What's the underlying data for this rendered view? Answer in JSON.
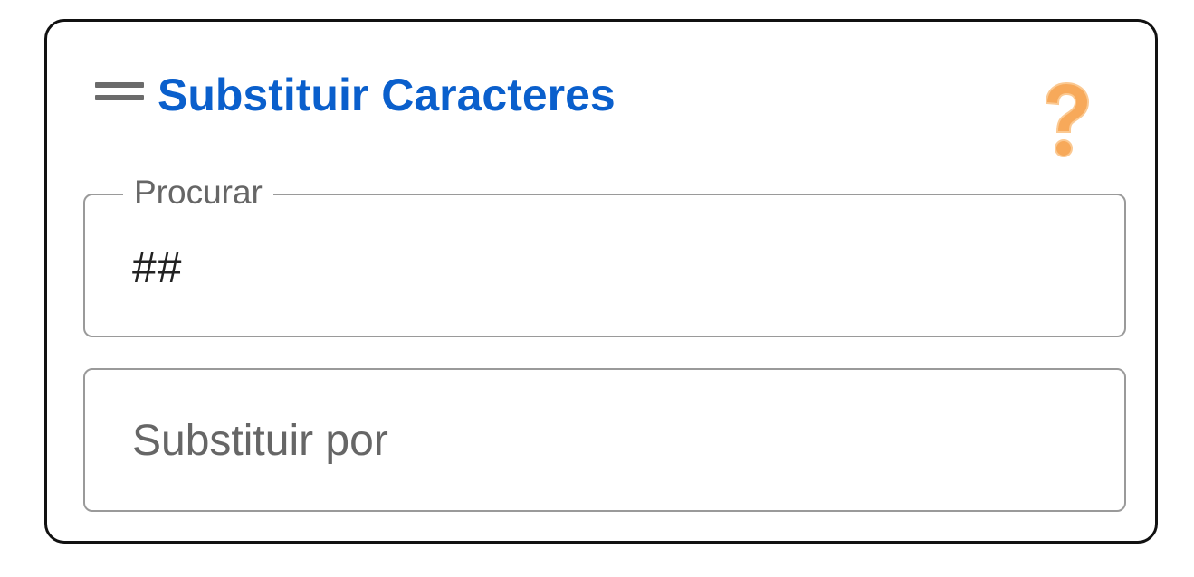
{
  "panel": {
    "title": "Substituir Caracteres",
    "title_color": "#0a5fcc",
    "drag_icon": "drag-handle-icon",
    "help_icon": "question-mark-icon",
    "help_icon_color": "#f7a95a"
  },
  "search_field": {
    "label": "Procurar",
    "value": "##"
  },
  "replace_field": {
    "placeholder": "Substituir por",
    "value": ""
  }
}
